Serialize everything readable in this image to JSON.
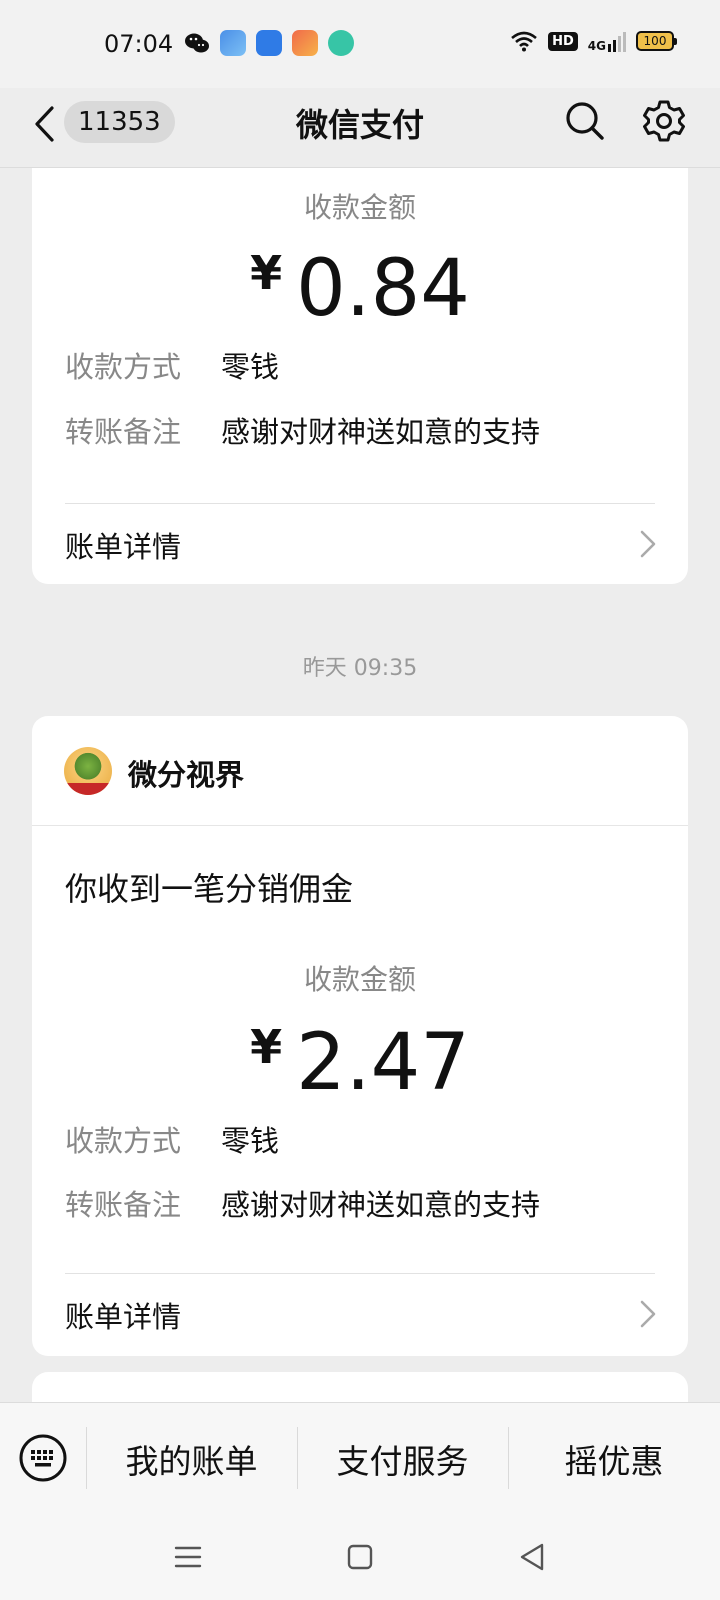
{
  "status_bar": {
    "time": "07:04",
    "network": "4G",
    "hd": "HD",
    "battery": "100",
    "app_icons": [
      "wechat-icon",
      "weather-app-icon",
      "files-app-icon",
      "game-app-icon",
      "message-app-icon"
    ]
  },
  "nav": {
    "back_icon": "chevron-left-icon",
    "unread_count": "11353",
    "title": "微信支付",
    "search_icon": "search-icon",
    "settings_icon": "gear-icon"
  },
  "messages": [
    {
      "amount_label": "收款金额",
      "currency": "¥",
      "amount": "0.84",
      "method_key": "收款方式",
      "method_value": "零钱",
      "note_key": "转账备注",
      "note_value": "感谢对财神送如意的支持",
      "detail_label": "账单详情"
    },
    {
      "timestamp": "昨天 09:35",
      "merchant_name": "微分视界",
      "notice_title": "你收到一笔分销佣金",
      "amount_label": "收款金额",
      "currency": "¥",
      "amount": "2.47",
      "method_key": "收款方式",
      "method_value": "零钱",
      "note_key": "转账备注",
      "note_value": "感谢对财神送如意的支持",
      "detail_label": "账单详情"
    }
  ],
  "bottom_menu": {
    "keyboard_icon": "keyboard-icon",
    "items": [
      "我的账单",
      "支付服务",
      "摇优惠"
    ]
  },
  "system_nav": {
    "menu_icon": "menu-icon",
    "home_icon": "home-icon",
    "back_icon": "back-triangle-icon"
  },
  "colors": {
    "background": "#ededed",
    "card": "#ffffff",
    "muted_text": "#888888",
    "primary_text": "#111111"
  }
}
